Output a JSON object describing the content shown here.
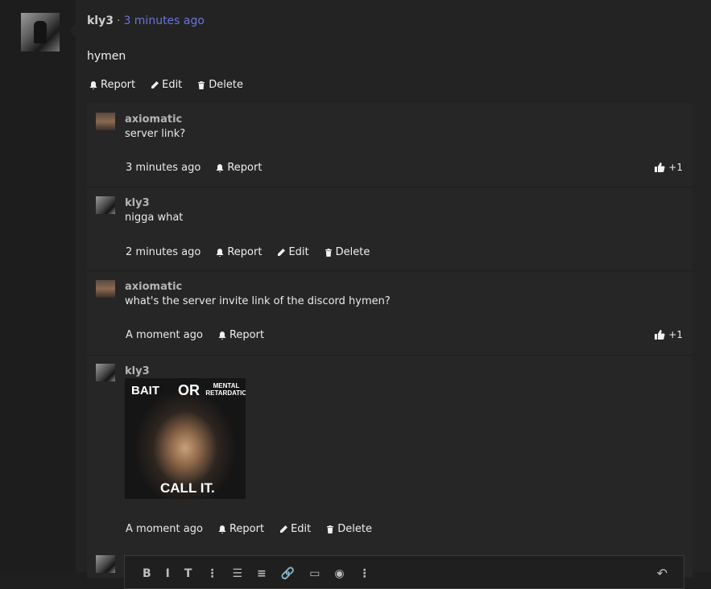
{
  "post": {
    "author": "kly3",
    "separator": "·",
    "time": "3 minutes ago",
    "body": "hymen",
    "actions": {
      "report": "Report",
      "edit": "Edit",
      "delete": "Delete"
    }
  },
  "replies": [
    {
      "author": "axiomatic",
      "text": "server link?",
      "time": "3 minutes ago",
      "report": "Report",
      "likes": "+1"
    },
    {
      "author": "kly3",
      "text": "nigga what",
      "time": "2 minutes ago",
      "report": "Report",
      "edit": "Edit",
      "delete": "Delete"
    },
    {
      "author": "axiomatic",
      "text": "what's the server invite link of the discord hymen?",
      "time": "A moment ago",
      "report": "Report",
      "likes": "+1"
    },
    {
      "author": "kly3",
      "time": "A moment ago",
      "report": "Report",
      "edit": "Edit",
      "delete": "Delete",
      "image": {
        "top_left": "BAIT",
        "top_middle": "OR",
        "top_right": "MENTAL RETARDATIO",
        "bottom": "CALL IT."
      }
    }
  ],
  "editor": {
    "toolbar": [
      "B",
      "I",
      "T",
      "⋮",
      "☰",
      "≡",
      "🔗",
      "▭",
      "◉",
      "⋮"
    ],
    "undo": "↶"
  },
  "colors": {
    "link": "#6b74d8",
    "background": "#232323"
  }
}
